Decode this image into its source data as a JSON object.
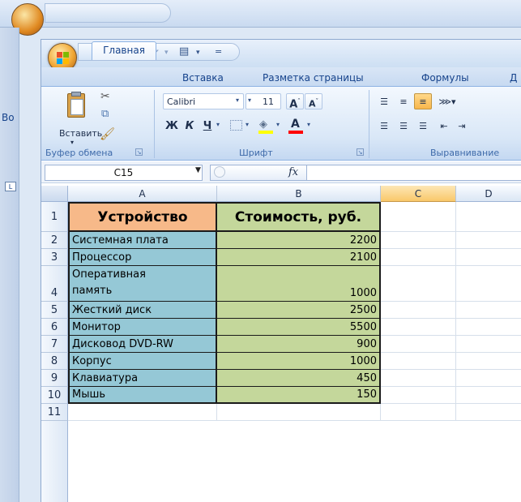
{
  "ribbon_tabs": [
    "Главная",
    "Вставка",
    "Разметка страницы",
    "Формулы",
    "Д"
  ],
  "outer_side_text": "Во",
  "outer_side_box": "L",
  "clipboard": {
    "paste_label": "Вставить",
    "group_label": "Буфер обмена"
  },
  "font": {
    "name": "Calibri",
    "size": "11",
    "bold": "Ж",
    "italic": "К",
    "underline": "Ч",
    "grow": "A",
    "shrink": "A",
    "font_color": "A",
    "group_label": "Шрифт"
  },
  "alignment": {
    "group_label": "Выравнивание"
  },
  "formula_bar": {
    "name_box": "C15",
    "fx_label": "fx",
    "value": ""
  },
  "columns": [
    "A",
    "B",
    "C",
    "D"
  ],
  "table": {
    "header": {
      "row": "1",
      "a": "Устройство",
      "b": "Стоимость, руб."
    },
    "rows": [
      {
        "row": "2",
        "a": "Системная плата",
        "b": "2200"
      },
      {
        "row": "3",
        "a": "Процессор",
        "b": "2100"
      },
      {
        "row": "4",
        "a1": "Оперативная",
        "a2": "память",
        "b": "1000"
      },
      {
        "row": "5",
        "a": "Жесткий диск",
        "b": "2500"
      },
      {
        "row": "6",
        "a": "Монитор",
        "b": "5500"
      },
      {
        "row": "7",
        "a": "Дисковод DVD-RW",
        "b": "900"
      },
      {
        "row": "8",
        "a": "Корпус",
        "b": "1000"
      },
      {
        "row": "9",
        "a": "Клавиатура",
        "b": "450"
      },
      {
        "row": "10",
        "a": "Мышь",
        "b": "150"
      }
    ],
    "empty_row": "11"
  },
  "colors": {
    "device_col": "#95c8d6",
    "price_col": "#c4d79b",
    "header_fill": "#f7b989",
    "selected_col_header": "#f9c86a"
  }
}
